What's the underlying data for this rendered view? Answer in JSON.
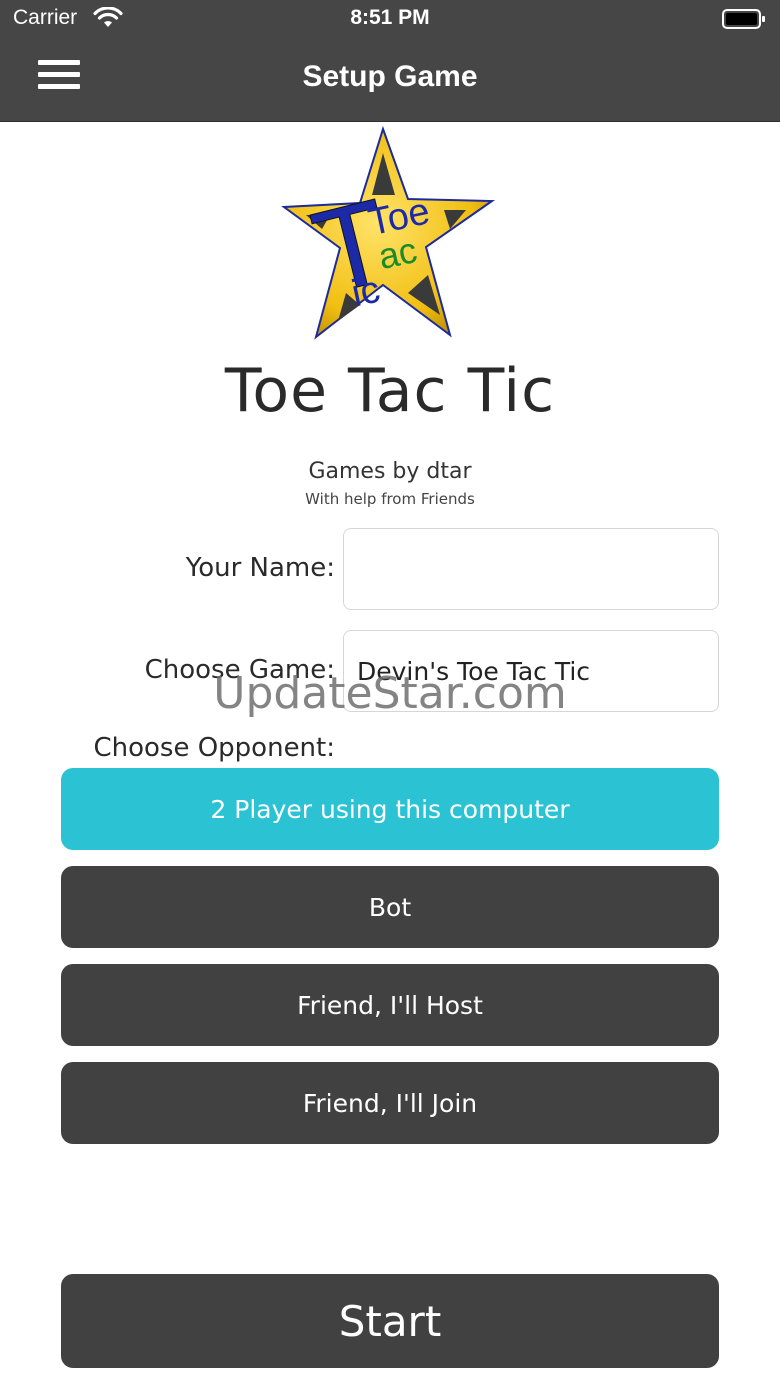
{
  "status_bar": {
    "carrier": "Carrier",
    "time": "8:51 PM"
  },
  "nav": {
    "title": "Setup Game",
    "menu_icon": "hamburger-menu-icon"
  },
  "logo": {
    "words": [
      "Toe",
      "ac",
      "T",
      "ic"
    ],
    "colors": {
      "star": "#f2c21a",
      "outline": "#1d2a9c",
      "text_blue": "#1d2aa8",
      "text_green": "#1a8a2a"
    }
  },
  "app": {
    "title": "Toe Tac Tic",
    "by": "Games by dtar",
    "help": "With help from Friends"
  },
  "form": {
    "name_label": "Your Name:",
    "name_value": "",
    "game_label": "Choose Game:",
    "game_value": "Devin's Toe Tac Tic",
    "opponent_label": "Choose Opponent:"
  },
  "opponents": {
    "two_player": "2 Player using this computer",
    "bot": "Bot",
    "host": "Friend, I'll Host",
    "join": "Friend, I'll Join",
    "selected": "2 Player using this computer"
  },
  "start_label": "Start",
  "watermark": "UpdateStar.com",
  "colors": {
    "topbar": "#464646",
    "button": "#414141",
    "selected_button": "#2bc3d3"
  }
}
